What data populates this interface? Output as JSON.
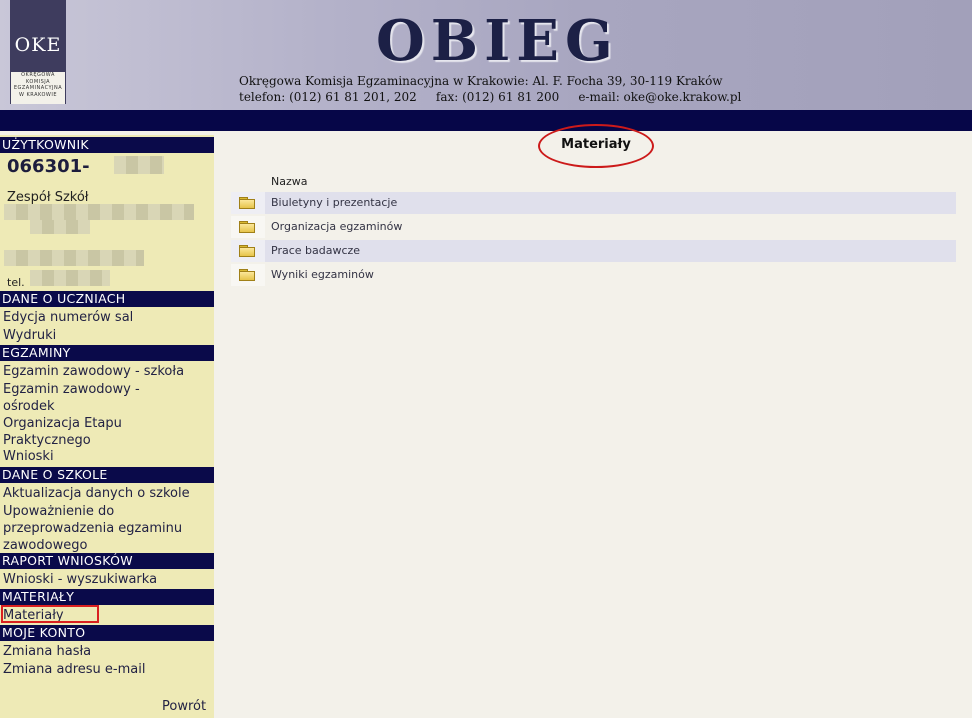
{
  "header": {
    "logo_text": "OKE",
    "logo_sub": [
      "OKRĘGOWA",
      "KOMISJA",
      "EGZAMINACYJNA",
      "W KRAKOWIE"
    ],
    "brand": "OBIEG",
    "address_line": "Okręgowa Komisja Egzaminacyjna w Krakowie: Al. F. Focha 39, 30-119 Kraków",
    "contact_line": "telefon: (012) 61 81 201, 202     fax: (012) 61 81 200     e-mail: oke@oke.krakow.pl"
  },
  "sidebar": {
    "user_section": "UŻYTKOWNIK",
    "user_id": "066301-",
    "school": "Zespół Szkół",
    "tel": "tel.",
    "sections": [
      {
        "title": "DANE O UCZNIACH",
        "items": [
          "Edycja numerów sal",
          "Wydruki"
        ]
      },
      {
        "title": "EGZAMINY",
        "items": [
          "Egzamin zawodowy - szkoła",
          "Egzamin zawodowy - ośrodek",
          "Organizacja Etapu Praktycznego",
          "Wnioski"
        ]
      },
      {
        "title": "DANE O SZKOLE",
        "items": [
          "Aktualizacja danych o szkole",
          "Upoważnienie do przeprowadzenia egzaminu zawodowego"
        ]
      },
      {
        "title": "RAPORT WNIOSKÓW",
        "items": [
          "Wnioski - wyszukiwarka"
        ]
      },
      {
        "title": "MATERIAŁY",
        "items": [
          "Materiały"
        ]
      },
      {
        "title": "MOJE KONTO",
        "items": [
          "Zmiana hasła",
          "Zmiana adresu e-mail"
        ]
      }
    ],
    "back": "Powrót"
  },
  "main": {
    "title": "Materiały",
    "column_header": "Nazwa",
    "folders": [
      "Biuletyny i prezentacje",
      "Organizacja egzaminów",
      "Prace badawcze",
      "Wyniki egzaminów"
    ]
  },
  "icons": {
    "folder": "folder-icon"
  },
  "colors": {
    "nav_band": "#060648",
    "section_header": "#0a0a4a",
    "sidebar_bg": "#eeeab6",
    "highlight": "#d92020"
  }
}
